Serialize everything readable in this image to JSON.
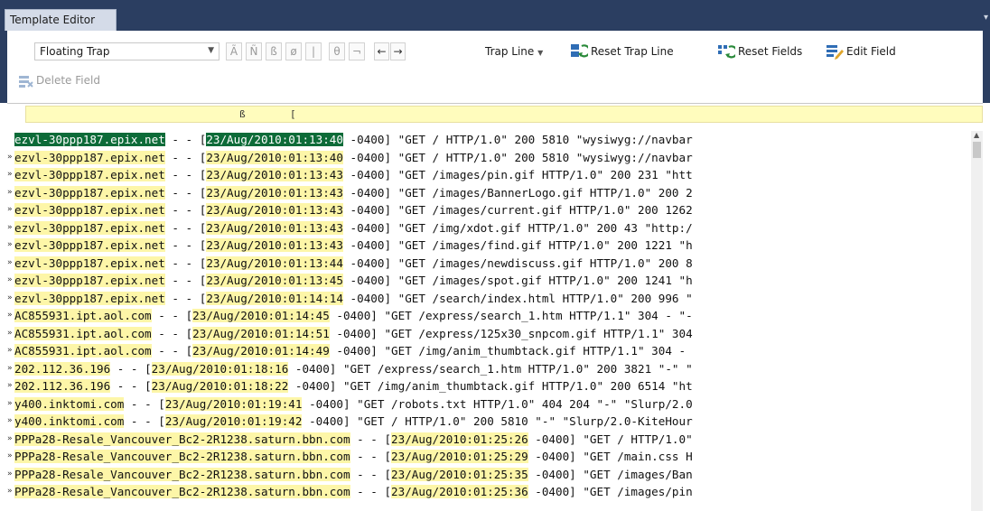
{
  "window": {
    "tab_title": "Template Editor",
    "menu_glyph": "▾"
  },
  "toolbar": {
    "trap_select": "Floating Trap",
    "char_buttons": [
      "Ã",
      "Ñ",
      "ß",
      "ø",
      "|",
      "θ",
      "¬"
    ],
    "arrow_left": "←",
    "arrow_right": "→",
    "trap_line_label": "Trap Line",
    "reset_trap_line_label": "Reset Trap Line",
    "reset_fields_label": "Reset Fields",
    "edit_field_label": "Edit Field",
    "delete_field_label": "Delete Field"
  },
  "ruler": {
    "markers": [
      "ß",
      "["
    ]
  },
  "colors": {
    "field_highlight": "#fdf6a8",
    "selection": "#0d6b38",
    "ruler_bg": "#fffcbd",
    "titlebar": "#2b3e61"
  },
  "lines": [
    {
      "marker": "",
      "segments": [
        {
          "t": "ezvl-30ppp187.epix.net",
          "s": "sel"
        },
        {
          "t": " - - ["
        },
        {
          "t": "23/Aug/2010:01:13:40",
          "s": "sel"
        },
        {
          "t": " -0400] \"GET / HTTP/1.0\" 200 5810 \"wysiwyg://navbar"
        }
      ]
    },
    {
      "marker": "»",
      "segments": [
        {
          "t": "ezvl-30ppp187.epix.net",
          "s": "hl"
        },
        {
          "t": " - - ["
        },
        {
          "t": "23/Aug/2010:01:13:40",
          "s": "hl"
        },
        {
          "t": " -0400] \"GET / HTTP/1.0\" 200 5810 \"wysiwyg://navbar"
        }
      ]
    },
    {
      "marker": "»",
      "segments": [
        {
          "t": "ezvl-30ppp187.epix.net",
          "s": "hl"
        },
        {
          "t": " - - ["
        },
        {
          "t": "23/Aug/2010:01:13:43",
          "s": "hl"
        },
        {
          "t": " -0400] \"GET /images/pin.gif HTTP/1.0\" 200 231 \"htt"
        }
      ]
    },
    {
      "marker": "»",
      "segments": [
        {
          "t": "ezvl-30ppp187.epix.net",
          "s": "hl"
        },
        {
          "t": " - - ["
        },
        {
          "t": "23/Aug/2010:01:13:43",
          "s": "hl"
        },
        {
          "t": " -0400] \"GET /images/BannerLogo.gif HTTP/1.0\" 200 2"
        }
      ]
    },
    {
      "marker": "»",
      "segments": [
        {
          "t": "ezvl-30ppp187.epix.net",
          "s": "hl"
        },
        {
          "t": " - - ["
        },
        {
          "t": "23/Aug/2010:01:13:43",
          "s": "hl"
        },
        {
          "t": " -0400] \"GET /images/current.gif HTTP/1.0\" 200 1262"
        }
      ]
    },
    {
      "marker": "»",
      "segments": [
        {
          "t": "ezvl-30ppp187.epix.net",
          "s": "hl"
        },
        {
          "t": " - - ["
        },
        {
          "t": "23/Aug/2010:01:13:43",
          "s": "hl"
        },
        {
          "t": " -0400] \"GET /img/xdot.gif HTTP/1.0\" 200 43 \"http:/"
        }
      ]
    },
    {
      "marker": "»",
      "segments": [
        {
          "t": "ezvl-30ppp187.epix.net",
          "s": "hl"
        },
        {
          "t": " - - ["
        },
        {
          "t": "23/Aug/2010:01:13:43",
          "s": "hl"
        },
        {
          "t": " -0400] \"GET /images/find.gif HTTP/1.0\" 200 1221 \"h"
        }
      ]
    },
    {
      "marker": "»",
      "segments": [
        {
          "t": "ezvl-30ppp187.epix.net",
          "s": "hl"
        },
        {
          "t": " - - ["
        },
        {
          "t": "23/Aug/2010:01:13:44",
          "s": "hl"
        },
        {
          "t": " -0400] \"GET /images/newdiscuss.gif HTTP/1.0\" 200 8"
        }
      ]
    },
    {
      "marker": "»",
      "segments": [
        {
          "t": "ezvl-30ppp187.epix.net",
          "s": "hl"
        },
        {
          "t": " - - ["
        },
        {
          "t": "23/Aug/2010:01:13:45",
          "s": "hl"
        },
        {
          "t": " -0400] \"GET /images/spot.gif HTTP/1.0\" 200 1241 \"h"
        }
      ]
    },
    {
      "marker": "»",
      "segments": [
        {
          "t": "ezvl-30ppp187.epix.net",
          "s": "hl"
        },
        {
          "t": " - - ["
        },
        {
          "t": "23/Aug/2010:01:14:14",
          "s": "hl"
        },
        {
          "t": " -0400] \"GET /search/index.html HTTP/1.0\" 200 996 \""
        }
      ]
    },
    {
      "marker": "»",
      "segments": [
        {
          "t": "AC855931.ipt.aol.com",
          "s": "hl"
        },
        {
          "t": " - - ["
        },
        {
          "t": "23/Aug/2010:01:14:45",
          "s": "hl"
        },
        {
          "t": " -0400] \"GET /express/search_1.htm HTTP/1.1\" 304 - \"-"
        }
      ]
    },
    {
      "marker": "»",
      "segments": [
        {
          "t": "AC855931.ipt.aol.com",
          "s": "hl"
        },
        {
          "t": " - - ["
        },
        {
          "t": "23/Aug/2010:01:14:51",
          "s": "hl"
        },
        {
          "t": " -0400] \"GET /express/125x30_snpcom.gif HTTP/1.1\" 304"
        }
      ]
    },
    {
      "marker": "»",
      "segments": [
        {
          "t": "AC855931.ipt.aol.com",
          "s": "hl"
        },
        {
          "t": " - - ["
        },
        {
          "t": "23/Aug/2010:01:14:49",
          "s": "hl"
        },
        {
          "t": " -0400] \"GET /img/anim_thumbtack.gif HTTP/1.1\" 304 -"
        }
      ]
    },
    {
      "marker": "»",
      "segments": [
        {
          "t": "202.112.36.196",
          "s": "hl"
        },
        {
          "t": " - - ["
        },
        {
          "t": "23/Aug/2010:01:18:16",
          "s": "hl"
        },
        {
          "t": " -0400] \"GET /express/search_1.htm HTTP/1.0\" 200 3821 \"-\" \""
        }
      ]
    },
    {
      "marker": "»",
      "segments": [
        {
          "t": "202.112.36.196",
          "s": "hl"
        },
        {
          "t": " - - ["
        },
        {
          "t": "23/Aug/2010:01:18:22",
          "s": "hl"
        },
        {
          "t": " -0400] \"GET /img/anim_thumbtack.gif HTTP/1.0\" 200 6514 \"ht"
        }
      ]
    },
    {
      "marker": "»",
      "segments": [
        {
          "t": "y400.inktomi.com",
          "s": "hl"
        },
        {
          "t": " - - ["
        },
        {
          "t": "23/Aug/2010:01:19:41",
          "s": "hl"
        },
        {
          "t": " -0400] \"GET /robots.txt HTTP/1.0\" 404 204 \"-\" \"Slurp/2.0"
        }
      ]
    },
    {
      "marker": "»",
      "segments": [
        {
          "t": "y400.inktomi.com",
          "s": "hl"
        },
        {
          "t": " - - ["
        },
        {
          "t": "23/Aug/2010:01:19:42",
          "s": "hl"
        },
        {
          "t": " -0400] \"GET / HTTP/1.0\" 200 5810 \"-\" \"Slurp/2.0-KiteHour"
        }
      ]
    },
    {
      "marker": "»",
      "segments": [
        {
          "t": "PPPa28-Resale_Vancouver_Bc2-2R1238.saturn.bbn.com",
          "s": "hl"
        },
        {
          "t": " - - ["
        },
        {
          "t": "23/Aug/2010:01:25:26",
          "s": "hl"
        },
        {
          "t": " -0400] \"GET / HTTP/1.0\""
        }
      ]
    },
    {
      "marker": "»",
      "segments": [
        {
          "t": "PPPa28-Resale_Vancouver_Bc2-2R1238.saturn.bbn.com",
          "s": "hl"
        },
        {
          "t": " - - ["
        },
        {
          "t": "23/Aug/2010:01:25:29",
          "s": "hl"
        },
        {
          "t": " -0400] \"GET /main.css H"
        }
      ]
    },
    {
      "marker": "»",
      "segments": [
        {
          "t": "PPPa28-Resale_Vancouver_Bc2-2R1238.saturn.bbn.com",
          "s": "hl"
        },
        {
          "t": " - - ["
        },
        {
          "t": "23/Aug/2010:01:25:35",
          "s": "hl"
        },
        {
          "t": " -0400] \"GET /images/Ban"
        }
      ]
    },
    {
      "marker": "»",
      "segments": [
        {
          "t": "PPPa28-Resale_Vancouver_Bc2-2R1238.saturn.bbn.com",
          "s": "hl"
        },
        {
          "t": " - - ["
        },
        {
          "t": "23/Aug/2010:01:25:36",
          "s": "hl"
        },
        {
          "t": " -0400] \"GET /images/pin"
        }
      ]
    }
  ]
}
